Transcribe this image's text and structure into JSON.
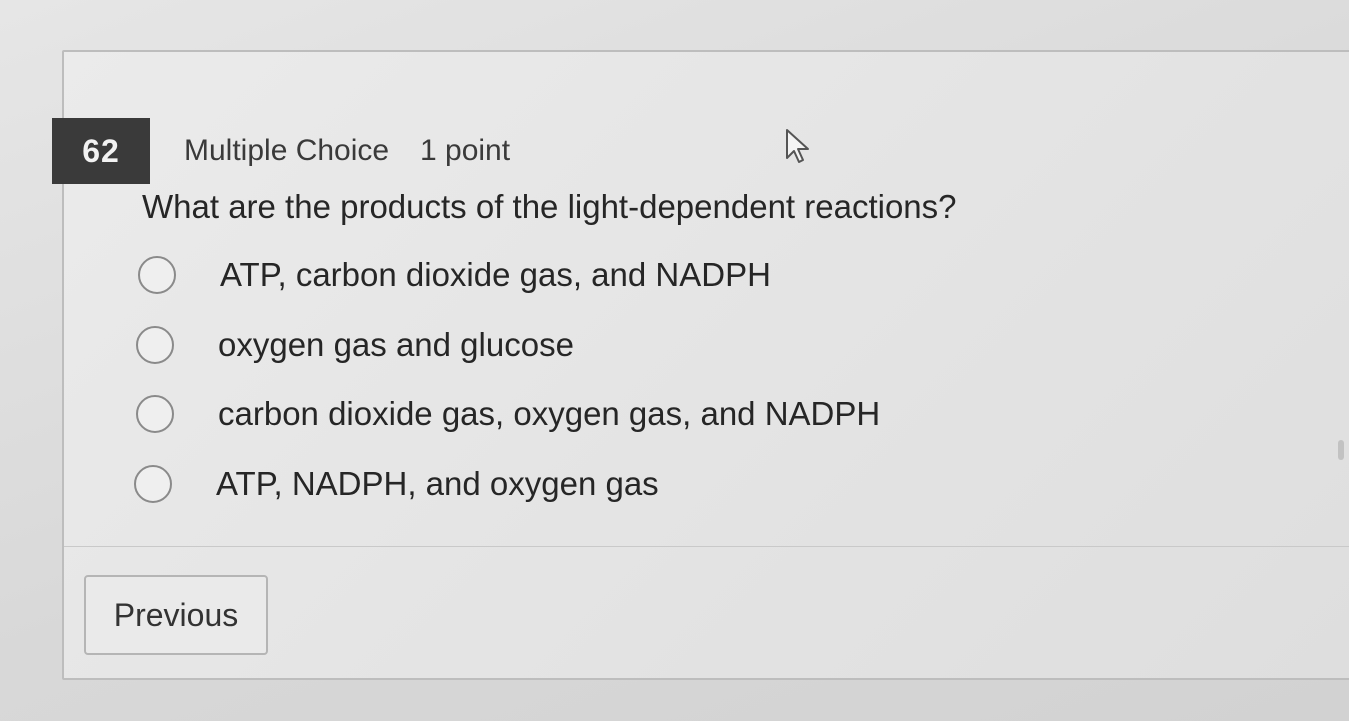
{
  "question": {
    "number": "62",
    "type": "Multiple Choice",
    "points": "1 point",
    "prompt": "What are the products of the light-dependent reactions?"
  },
  "options": [
    {
      "label": "ATP, carbon dioxide gas, and NADPH",
      "selected": false
    },
    {
      "label": "oxygen gas and glucose",
      "selected": false
    },
    {
      "label": "carbon dioxide gas, oxygen gas, and NADPH",
      "selected": false
    },
    {
      "label": "ATP, NADPH, and oxygen gas",
      "selected": false
    }
  ],
  "navigation": {
    "previous_label": "Previous"
  },
  "icons": {
    "cursor": "mouse-pointer-icon"
  }
}
